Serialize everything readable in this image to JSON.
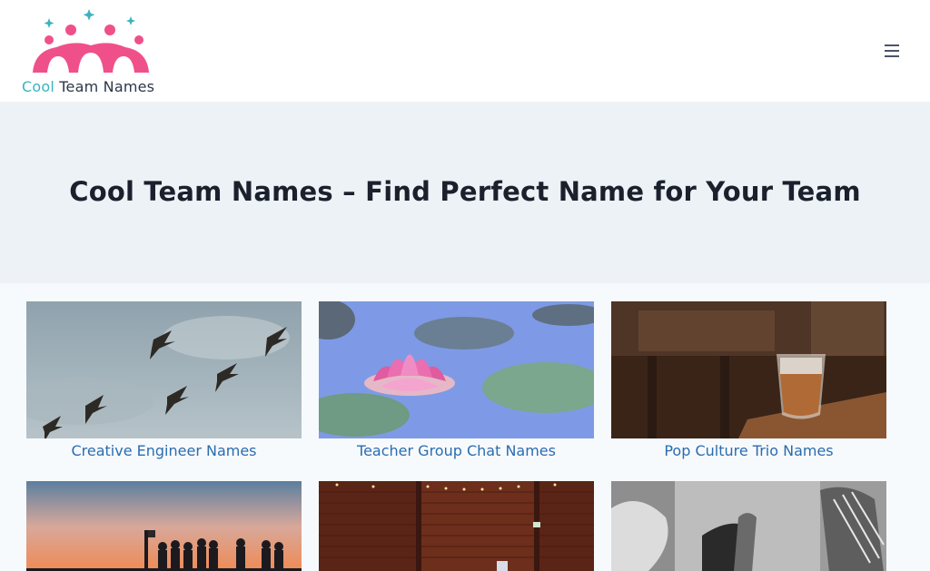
{
  "site": {
    "logo_accent": "Cool",
    "logo_rest": " Team Names",
    "logo_icon": "team-people-logo-icon",
    "brand_pink": "#f0508a",
    "brand_teal": "#3bb3bd"
  },
  "header": {
    "menu_icon": "hamburger-menu-icon"
  },
  "hero": {
    "title": "Cool Team Names – Find Perfect Name for Your Team"
  },
  "posts": [
    {
      "title": "Creative Engineer Names",
      "image": "pelicans-in-sky-photo"
    },
    {
      "title": "Teacher Group Chat Names",
      "image": "pink-water-lily-photo"
    },
    {
      "title": "Pop Culture Trio Names",
      "image": "iced-coffee-cafe-photo"
    },
    {
      "title": "",
      "image": "sunset-silhouettes-photo"
    },
    {
      "title": "",
      "image": "brick-wall-lights-photo"
    },
    {
      "title": "",
      "image": "holding-hands-bw-photo"
    }
  ]
}
